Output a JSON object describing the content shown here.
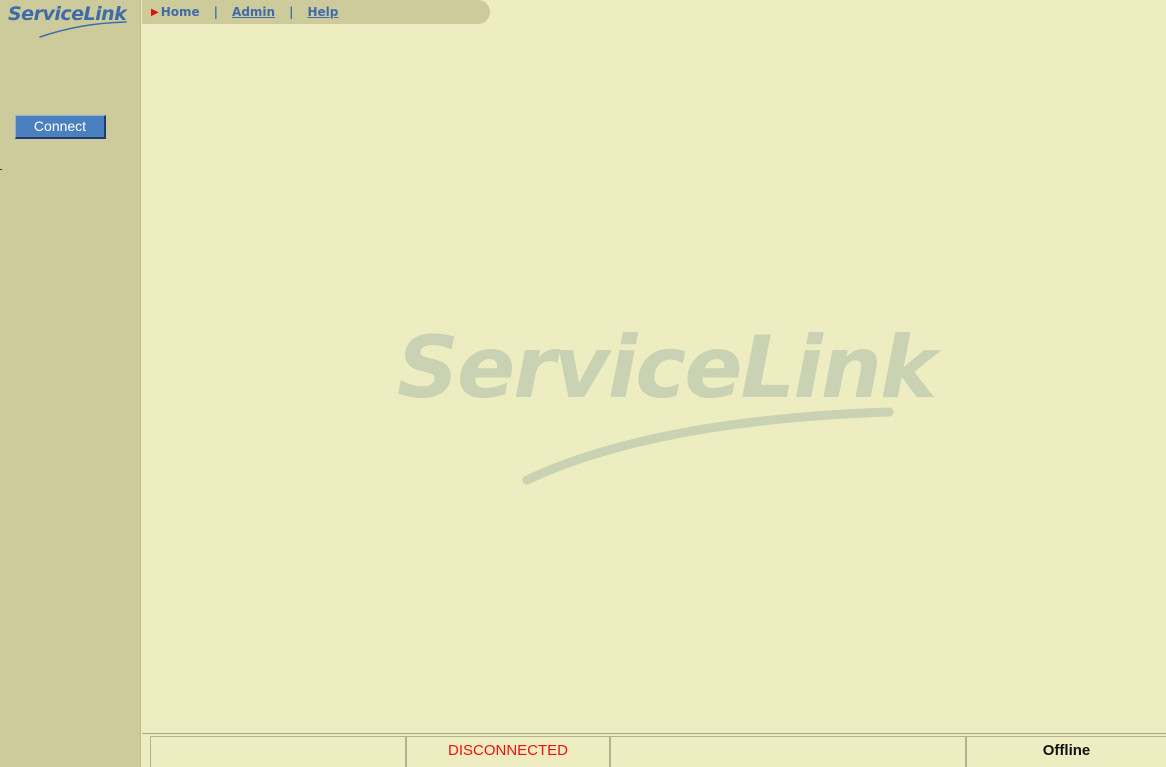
{
  "app": {
    "logo_text": "ServiceLink",
    "watermark_text": "ServiceLink"
  },
  "nav": {
    "home_label": "Home",
    "separator": "|",
    "admin_label": "Admin",
    "help_label": "Help"
  },
  "sidebar": {
    "connect_label": "Connect"
  },
  "status": {
    "cell1": "",
    "connection": "DISCONNECTED",
    "cell3": "",
    "mode": "Offline"
  },
  "colors": {
    "background": "#eeedc1",
    "sidebar": "#cdca9b",
    "brand_blue": "#3f6ca8",
    "button_blue": "#4a7fc0",
    "status_red": "#ee1111",
    "watermark": "#c9d2b2"
  }
}
